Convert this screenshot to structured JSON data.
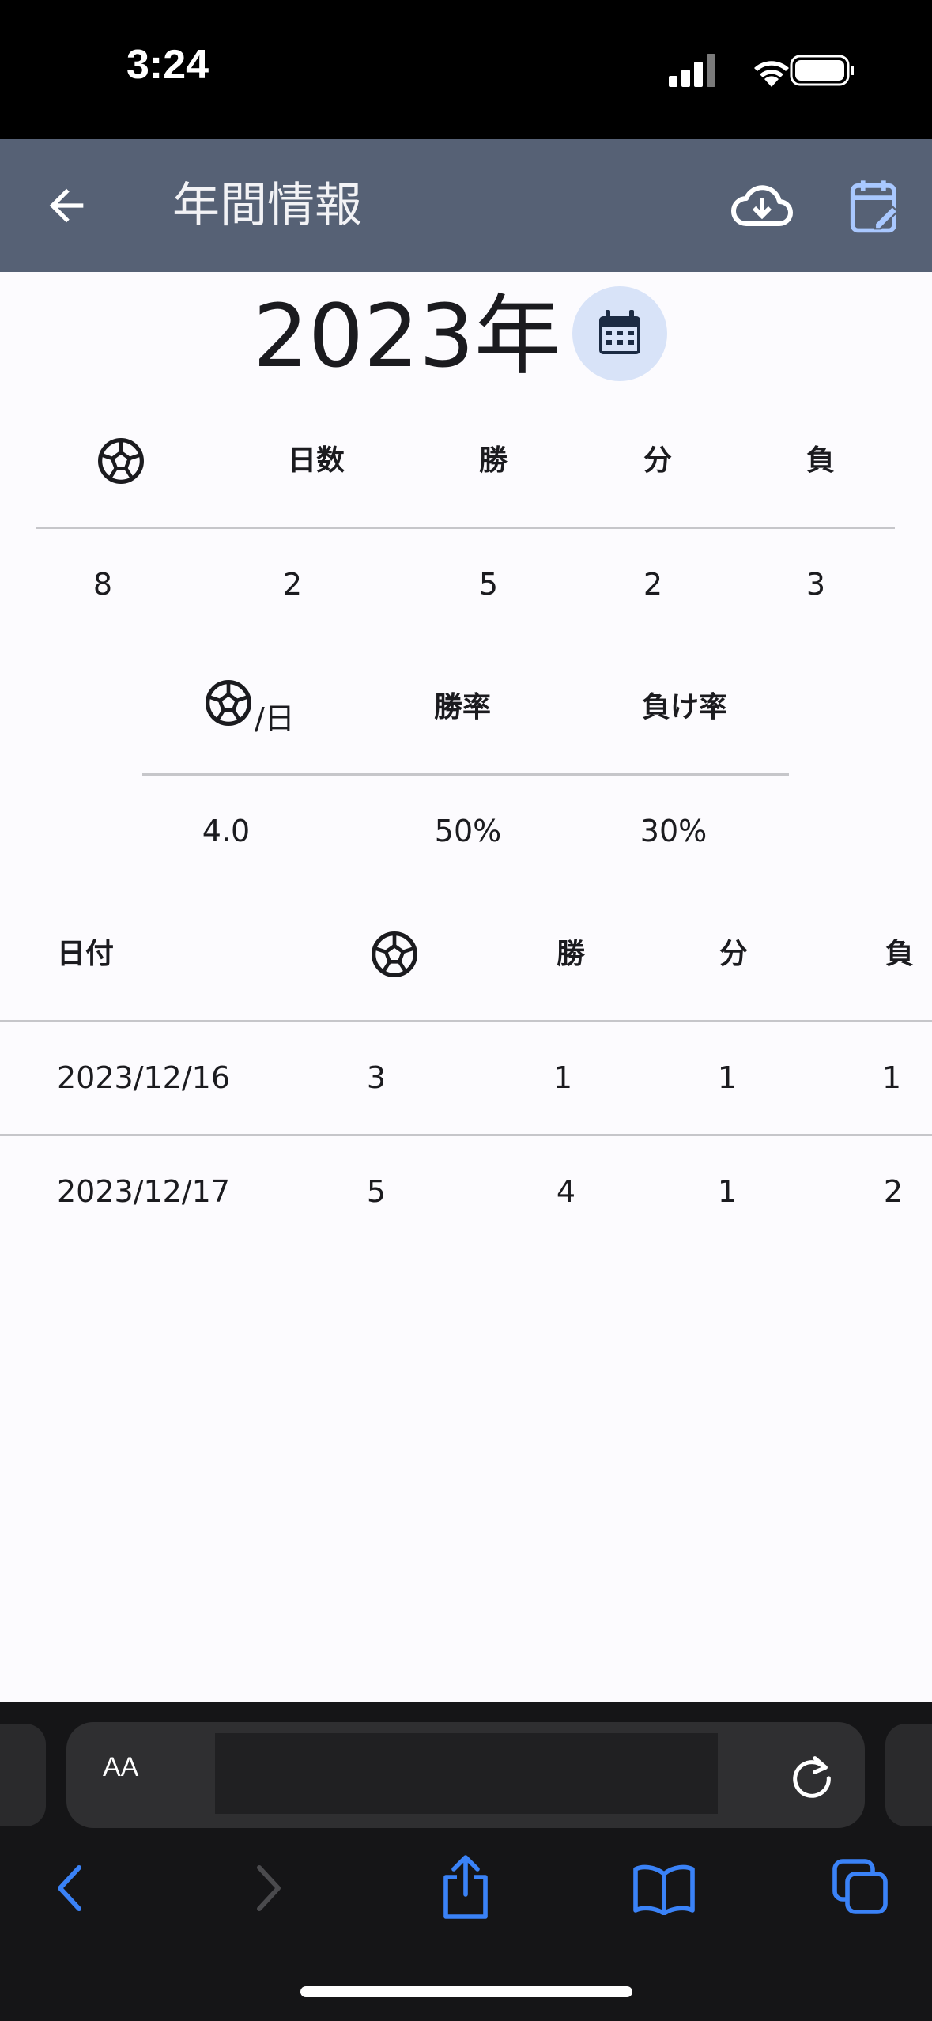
{
  "status_bar": {
    "time": "3:24"
  },
  "app_bar": {
    "title": "年間情報",
    "icons": [
      "back-arrow-icon",
      "cloud-download-icon",
      "edit-calendar-icon"
    ]
  },
  "year": {
    "label": "2023年",
    "calendar_icon": "calendar-icon"
  },
  "summary": {
    "headers": [
      "soccer-ball-icon",
      "日数",
      "勝",
      "分",
      "負"
    ],
    "values": [
      "8",
      "2",
      "5",
      "2",
      "3"
    ]
  },
  "rates": {
    "per_day_unit": "/日",
    "headers": [
      "勝率",
      "負け率"
    ],
    "values": [
      "4.0",
      "50%",
      "30%"
    ]
  },
  "daily": {
    "headers": [
      "日付",
      "soccer-ball-icon",
      "勝",
      "分",
      "負"
    ],
    "rows": [
      [
        "2023/12/16",
        "3",
        "1",
        "1",
        "1"
      ],
      [
        "2023/12/17",
        "5",
        "4",
        "1",
        "2"
      ]
    ]
  },
  "browser": {
    "aa_label": "AA",
    "icons": [
      "reload-icon",
      "back-chevron-icon",
      "forward-chevron-icon",
      "share-icon",
      "bookmarks-icon",
      "tabs-icon"
    ]
  },
  "colors": {
    "app_bar": "#566175",
    "accent_blue": "#a9c8ff",
    "calendar_button": "#d8e3f8"
  }
}
